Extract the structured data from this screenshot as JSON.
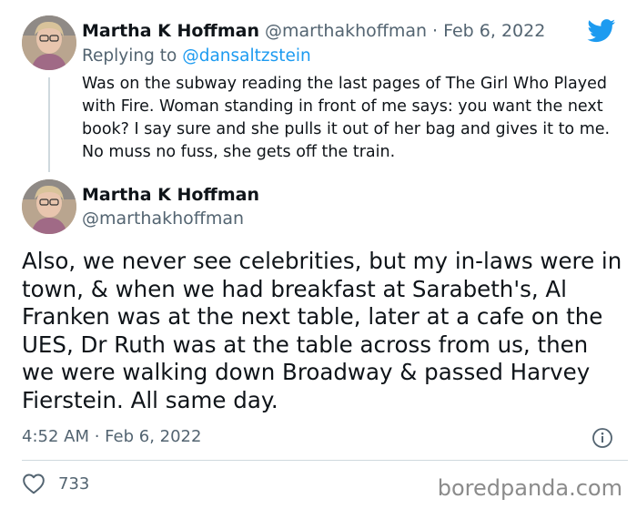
{
  "reply_tweet": {
    "author_name": "Martha K Hoffman",
    "handle": "@marthakhoffman",
    "separator": "·",
    "date": "Feb 6, 2022",
    "replying_to_prefix": "Replying to",
    "replying_to_handle": "@dansaltzstein",
    "text": "Was on the subway reading the last pages of The Girl Who Played with Fire. Woman standing in front of me says: you want the next book? I say sure and she pulls it out of her bag and gives it to me. No muss no fuss, she gets off the train."
  },
  "main_tweet": {
    "author_name": "Martha K Hoffman",
    "handle": "@marthakhoffman",
    "text": "Also, we never see celebrities, but my in-laws were in town, & when we had breakfast at Sarabeth's, Al Franken was at the next table, later at a cafe on the UES, Dr Ruth was at the table across from us, then we were walking down Broadway & passed Harvey Fierstein. All same day.",
    "timestamp": "4:52 AM · Feb 6, 2022",
    "like_count": "733"
  },
  "watermark": "boredpanda.com",
  "colors": {
    "twitter_blue": "#1d9bf0",
    "text": "#0f1419",
    "muted": "#536471",
    "line": "#cfd9de"
  },
  "icons": {
    "brand": "twitter-bird-icon",
    "info": "info-icon",
    "like": "heart-icon"
  }
}
